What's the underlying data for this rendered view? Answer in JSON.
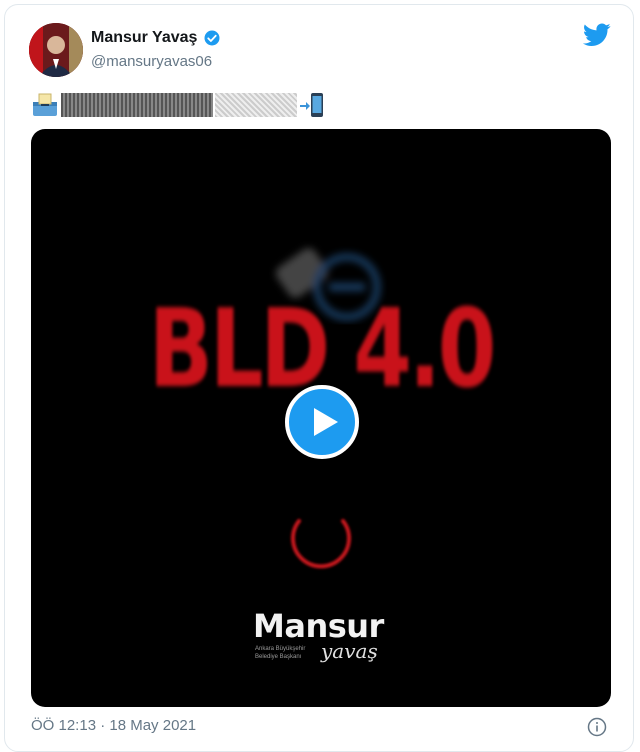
{
  "tweet": {
    "author_name": "Mansur Yavaş",
    "author_handle": "@mansuryavas06",
    "text_icons": [
      "ballot-box-emoji",
      "redacted-text",
      "arrow-phone-emoji"
    ],
    "timestamp": "ÖÖ 12:13 · 18 May 2021"
  },
  "media": {
    "headline": "BLD 4.0",
    "brand_name": "Mansur",
    "brand_script": "yavaş",
    "brand_sub_line1": "Ankara Büyükşehir",
    "brand_sub_line2": "Belediye Başkanı"
  },
  "colors": {
    "twitter_blue": "#1d9bf0",
    "headline_red": "#d4141c",
    "muted_gray": "#657786"
  }
}
